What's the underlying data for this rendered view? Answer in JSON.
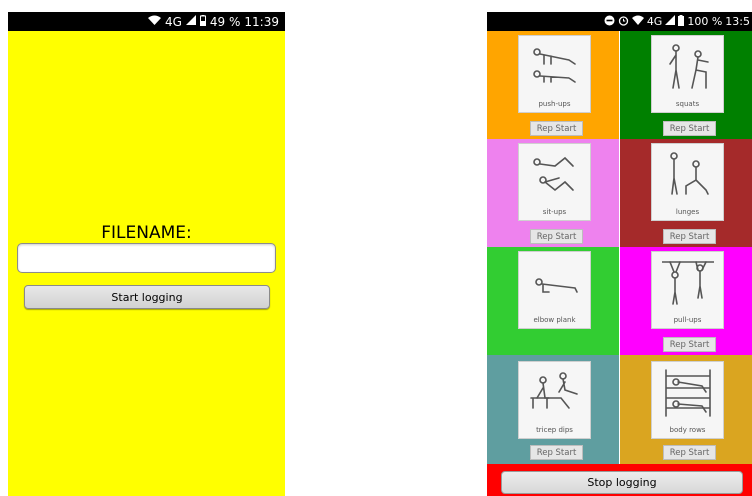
{
  "left": {
    "statusbar": {
      "icons": [
        "wifi-icon",
        "signal-icon",
        "battery-icon"
      ],
      "network": "4G",
      "battery": "49 %",
      "time": "11:39"
    },
    "background": "#ffff00",
    "filename_label": "FILENAME:",
    "filename_value": "",
    "start_button": "Start logging"
  },
  "right": {
    "statusbar": {
      "icons": [
        "dnd-icon",
        "alarm-icon",
        "wifi-icon",
        "signal-icon",
        "battery-icon"
      ],
      "network": "4G",
      "battery": "100 %",
      "time": "13:5"
    },
    "exercises": [
      {
        "label": "push-ups",
        "color": "#ffa500",
        "icon": "push-ups-icon",
        "button": "Rep Start"
      },
      {
        "label": "squats",
        "color": "#008000",
        "icon": "squats-icon",
        "button": "Rep Start"
      },
      {
        "label": "sit-ups",
        "color": "#ee82ee",
        "icon": "sit-ups-icon",
        "button": "Rep Start"
      },
      {
        "label": "lunges",
        "color": "#a52a2a",
        "icon": "lunges-icon",
        "button": "Rep Start"
      },
      {
        "label": "elbow plank",
        "color": "#32cd32",
        "icon": "elbow-plank-icon",
        "button": ""
      },
      {
        "label": "pull-ups",
        "color": "#ff00ff",
        "icon": "pull-ups-icon",
        "button": "Rep Start"
      },
      {
        "label": "tricep dips",
        "color": "#5f9ea0",
        "icon": "tricep-dips-icon",
        "button": "Rep Start"
      },
      {
        "label": "body rows",
        "color": "#daa520",
        "icon": "body-rows-icon",
        "button": "Rep Start"
      }
    ],
    "footer_color": "#ff0000",
    "stop_button": "Stop logging"
  }
}
